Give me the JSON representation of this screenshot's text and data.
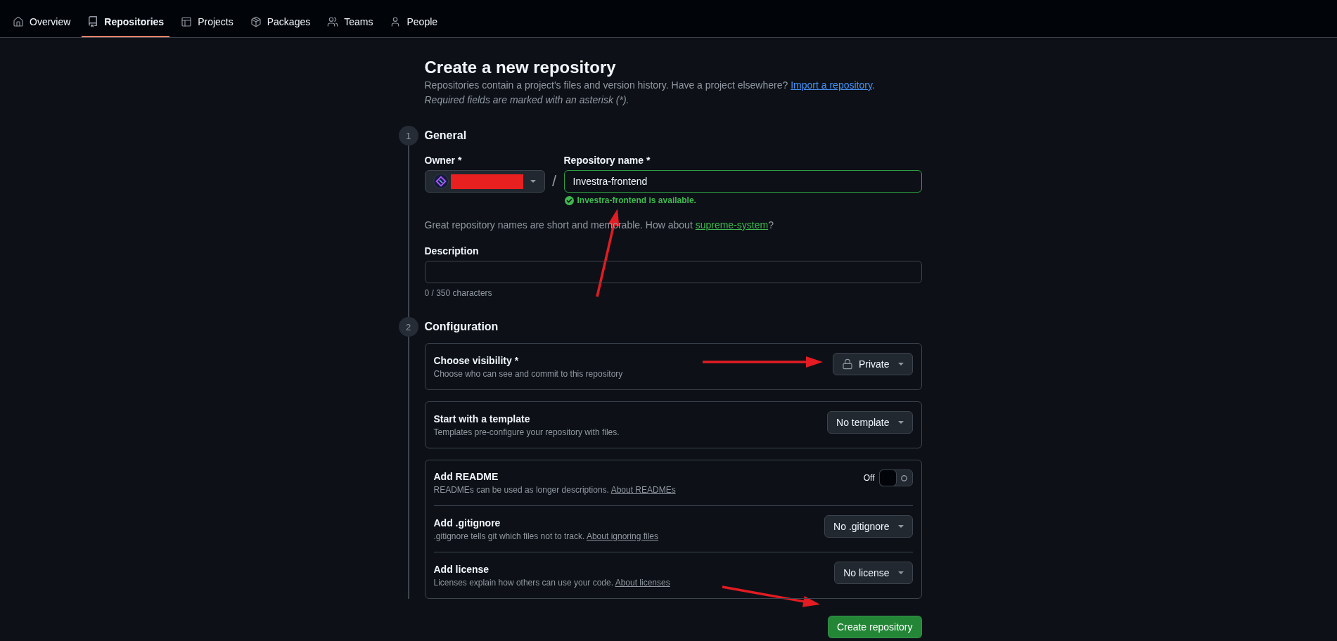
{
  "nav": {
    "tabs": [
      {
        "label": "Overview",
        "selected": false
      },
      {
        "label": "Repositories",
        "selected": true
      },
      {
        "label": "Projects",
        "selected": false
      },
      {
        "label": "Packages",
        "selected": false
      },
      {
        "label": "Teams",
        "selected": false
      },
      {
        "label": "People",
        "selected": false
      }
    ]
  },
  "header": {
    "title": "Create a new repository",
    "intro": {
      "text": "Repositories contain a project's files and version history. Have a project elsewhere?",
      "link": "Import a repository",
      "after": "."
    },
    "required_note": "Required fields are marked with an asterisk (*)."
  },
  "general": {
    "step": "1",
    "title": "General",
    "owner": {
      "label": "Owner *",
      "redacted": true
    },
    "separator": "/",
    "repo_name": {
      "label": "Repository name *",
      "value": "Investra-frontend",
      "valid": true,
      "message": "Investra-frontend is available."
    },
    "suggestion": {
      "text": "Great repository names are short and memorable. How about",
      "link": "supreme-system",
      "after": "?"
    },
    "description": {
      "label": "Description",
      "counter": "0 / 350 characters"
    }
  },
  "configuration": {
    "step": "2",
    "title": "Configuration",
    "cards": [
      {
        "rows": [
          {
            "kind": "visibility",
            "title": "Choose visibility *",
            "description": "Choose who can see and commit to this repository",
            "value": "Private"
          }
        ]
      },
      {
        "rows": [
          {
            "kind": "select",
            "title": "Start with a template",
            "description": "Templates pre-configure your repository with files.",
            "value": "No template"
          }
        ]
      },
      {
        "rows": [
          {
            "kind": "toggle",
            "title": "Add README",
            "description": "READMEs can be used as longer descriptions.",
            "link": "About READMEs",
            "state_label": "Off",
            "on": false
          },
          {
            "kind": "select",
            "title": "Add .gitignore",
            "description": ".gitignore tells git which files not to track.",
            "link": "About ignoring files",
            "value": "No .gitignore"
          },
          {
            "kind": "select",
            "title": "Add license",
            "description": "Licenses explain how others can use your code.",
            "link": "About licenses",
            "value": "No license"
          }
        ]
      }
    ]
  },
  "submit": {
    "label": "Create repository"
  }
}
